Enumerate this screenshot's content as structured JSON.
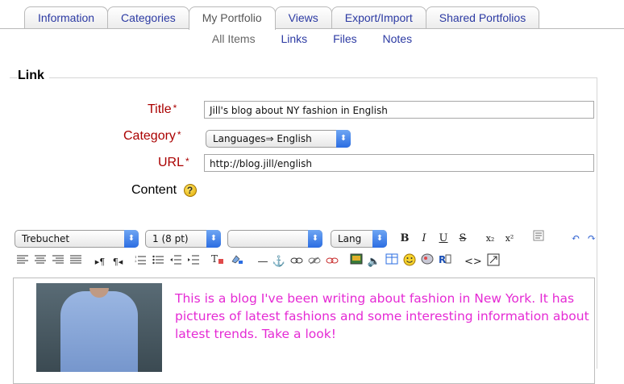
{
  "tabs": [
    {
      "label": "Information",
      "active": false
    },
    {
      "label": "Categories",
      "active": false
    },
    {
      "label": "My Portfolio",
      "active": true
    },
    {
      "label": "Views",
      "active": false
    },
    {
      "label": "Export/Import",
      "active": false
    },
    {
      "label": "Shared Portfolios",
      "active": false
    }
  ],
  "subnav": [
    {
      "label": "All Items",
      "current": true
    },
    {
      "label": "Links",
      "current": false
    },
    {
      "label": "Files",
      "current": false
    },
    {
      "label": "Notes",
      "current": false
    }
  ],
  "form": {
    "legend": "Link",
    "title_label": "Title",
    "title_value": "Jill's blog about NY fashion in English",
    "category_label": "Category",
    "category_value": "Languages⇒ English",
    "url_label": "URL",
    "url_value": "http://blog.jill/english",
    "content_label": "Content",
    "required_mark": "*",
    "help_glyph": "?"
  },
  "editor": {
    "font_select": "Trebuchet",
    "size_select": "1 (8 pt)",
    "format_select": "",
    "lang_select": "Lang",
    "buttons": {
      "bold": "B",
      "italic": "I",
      "underline": "U",
      "strike": "S",
      "subscript": "x₂",
      "superscript": "x²",
      "undo": "↶",
      "redo": "↷"
    },
    "content_text": "This is a blog I've been writing about fashion in New York. It has pictures of latest fashions and some interesting information about latest trends. Take a look!",
    "content_color": "#e52ad4"
  },
  "colors": {
    "link": "#2c3aa3",
    "required": "#aa0000"
  }
}
